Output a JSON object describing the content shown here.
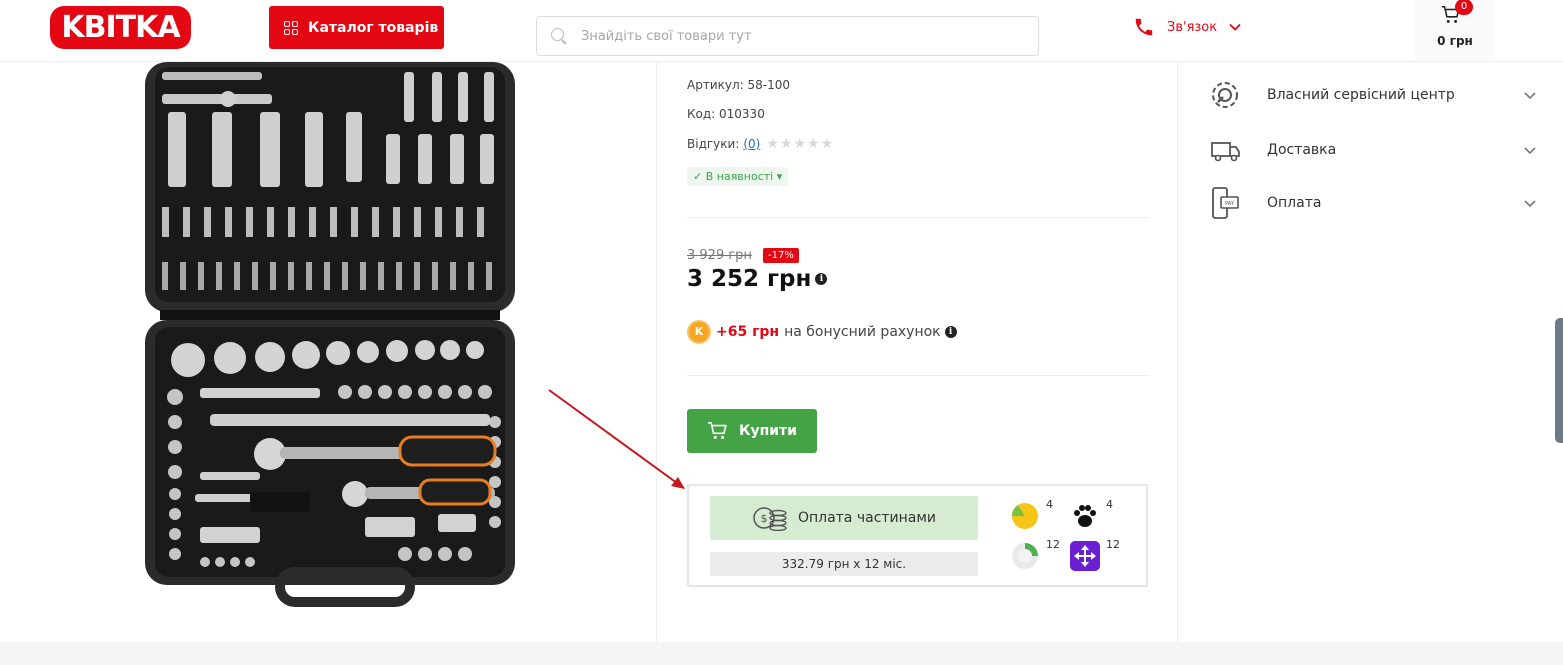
{
  "header": {
    "logo": "KBITKA",
    "catalog_label": "Каталог товарів",
    "search_placeholder": "Знайдіть свої товари тут",
    "contact_label": "Зв'язок",
    "cart_count": "0",
    "cart_total": "0 грн"
  },
  "product": {
    "article": "Артикул: 58-100",
    "code": "Код: 010330",
    "reviews_label": "Відгуки:",
    "reviews_count": "(0)",
    "stars": "★★★★★",
    "stock": "✓ В наявності ▾",
    "old_price": "3 929 грн",
    "discount": "-17%",
    "price": "3 252 грн",
    "bonus_amount": "+65 грн",
    "bonus_text": "на бонусний рахунок",
    "buy_label": "Купити"
  },
  "installments": {
    "button_label": "Оплата частинами",
    "monthly": "332.79 грн x 12 міс.",
    "banks": [
      {
        "icon": "pie-bank-icon",
        "count": "4"
      },
      {
        "icon": "paw-bank-icon",
        "count": "4"
      },
      {
        "icon": "moon-bank-icon",
        "count": "12"
      },
      {
        "icon": "arrows-bank-icon",
        "count": "12"
      }
    ]
  },
  "sidebar": {
    "items": [
      {
        "label": "Власний сервісний центр",
        "icon": "gear-wrench-icon"
      },
      {
        "label": "Доставка",
        "icon": "truck-icon"
      },
      {
        "label": "Оплата",
        "icon": "payment-icon"
      }
    ]
  },
  "colors": {
    "brand_red": "#e30613",
    "buy_green": "#44a445",
    "installment_green": "#d5ecd1"
  }
}
